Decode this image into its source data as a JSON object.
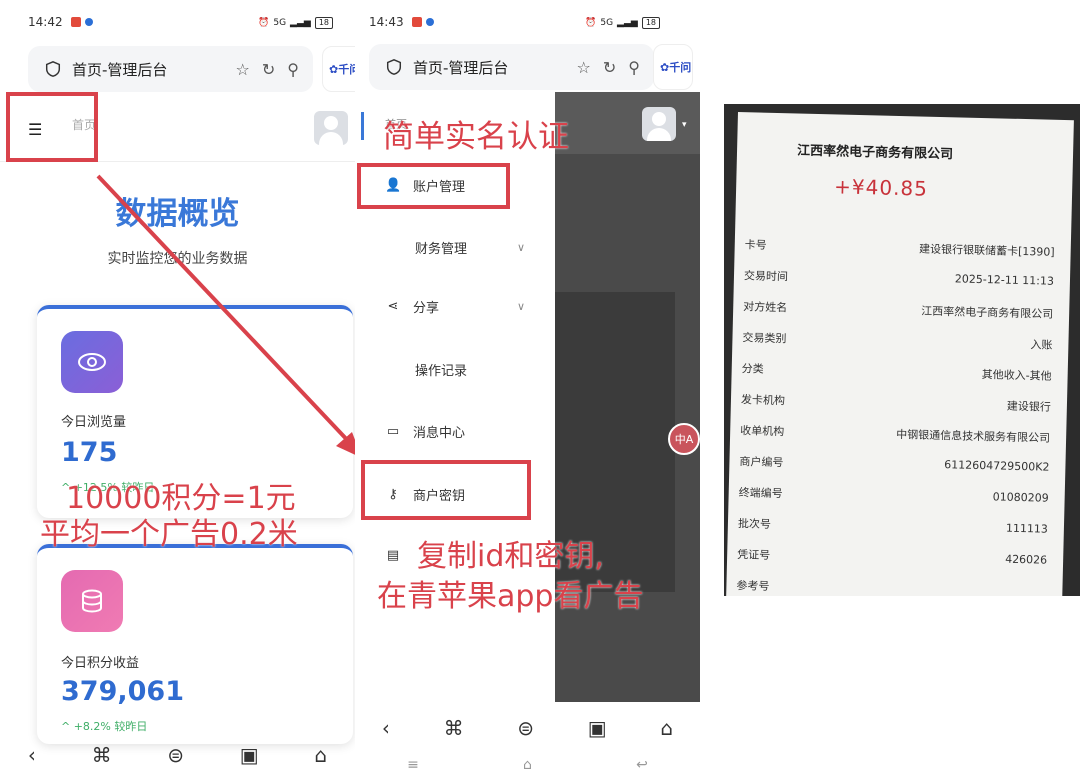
{
  "left": {
    "status": {
      "time": "14:42",
      "right": "5G",
      "battery": "18"
    },
    "browser": {
      "title": "首页-管理后台",
      "qianwen": "千问"
    },
    "crumb": "首页",
    "title": "数据概览",
    "subtitle": "实时监控您的业务数据",
    "card1": {
      "label": "今日浏览量",
      "value": "175",
      "trend": "^ +12.5% 较昨日"
    },
    "card2": {
      "label": "今日积分收益",
      "value": "379,061",
      "trend": "^ +8.2% 较昨日"
    },
    "overlay1": "10000积分=1元",
    "overlay2": "平均一个广告0.2米"
  },
  "middle": {
    "status": {
      "time": "14:43",
      "right": "5G",
      "battery": "18"
    },
    "browser": {
      "title": "首页-管理后台",
      "qianwen": "千问"
    },
    "crumb": "首页",
    "menu": {
      "account": "账户管理",
      "finance": "财务管理",
      "share": "分享",
      "oplog": "操作记录",
      "message": "消息中心",
      "merchant_key": "商户密钥"
    },
    "overlay_title": "简单实名认证",
    "overlay_bottom1": "复制id和密钥,",
    "overlay_bottom2": "在青苹果app看广告"
  },
  "receipt": {
    "company": "江西率然电子商务有限公司",
    "amount": "+¥40.85",
    "rows": [
      {
        "k": "卡号",
        "v": "建设银行银联储蓄卡[1390]"
      },
      {
        "k": "交易时间",
        "v": "2025-12-11 11:13"
      },
      {
        "k": "对方姓名",
        "v": "江西率然电子商务有限公司"
      },
      {
        "k": "交易类别",
        "v": "入账"
      },
      {
        "k": "分类",
        "v": "其他收入-其他"
      },
      {
        "k": "发卡机构",
        "v": "建设银行"
      },
      {
        "k": "收单机构",
        "v": "中钢银通信息技术服务有限公司"
      },
      {
        "k": "商户编号",
        "v": "6112604729500K2"
      },
      {
        "k": "终端编号",
        "v": "01080209"
      },
      {
        "k": "批次号",
        "v": "111113"
      },
      {
        "k": "凭证号",
        "v": "426026"
      },
      {
        "k": "参考号",
        "v": ""
      }
    ]
  },
  "colors": {
    "accent": "#3a78d8",
    "annotation": "#d9424b",
    "trend": "#3fae67"
  }
}
